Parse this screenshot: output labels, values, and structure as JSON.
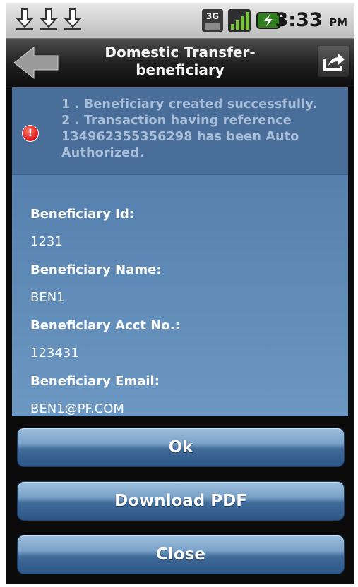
{
  "status_bar": {
    "time": "3:33",
    "ampm": "PM",
    "network_label": "3G",
    "icons": [
      "download-icon",
      "download-icon",
      "download-icon",
      "3g-icon",
      "signal-icon",
      "battery-charging-icon"
    ]
  },
  "header": {
    "title_line1": "Domestic Transfer-",
    "title_line2": "beneficiary",
    "back_icon": "back-arrow-icon",
    "share_icon": "share-icon"
  },
  "message": {
    "lines": [
      "1 . Beneficiary created successfully.",
      "2 . Transaction having reference",
      "134962355356298 has been Auto",
      "Authorized."
    ],
    "icon": "alert-icon",
    "icon_glyph": "!"
  },
  "details": [
    {
      "label": "Beneficiary Id:",
      "value": "1231"
    },
    {
      "label": "Beneficiary Name:",
      "value": "BEN1"
    },
    {
      "label": "Beneficiary Acct No.:",
      "value": "123431"
    },
    {
      "label": "Beneficiary Email:",
      "value": "BEN1@PF.COM"
    }
  ],
  "buttons": {
    "ok": "Ok",
    "download_pdf": "Download PDF",
    "close": "Close"
  },
  "colors": {
    "content_bg": "#5b86b3",
    "message_bg": "#4a6e9a",
    "button_top": "#9fc0de",
    "button_bottom": "#2c5786",
    "alert": "#d8161a"
  }
}
